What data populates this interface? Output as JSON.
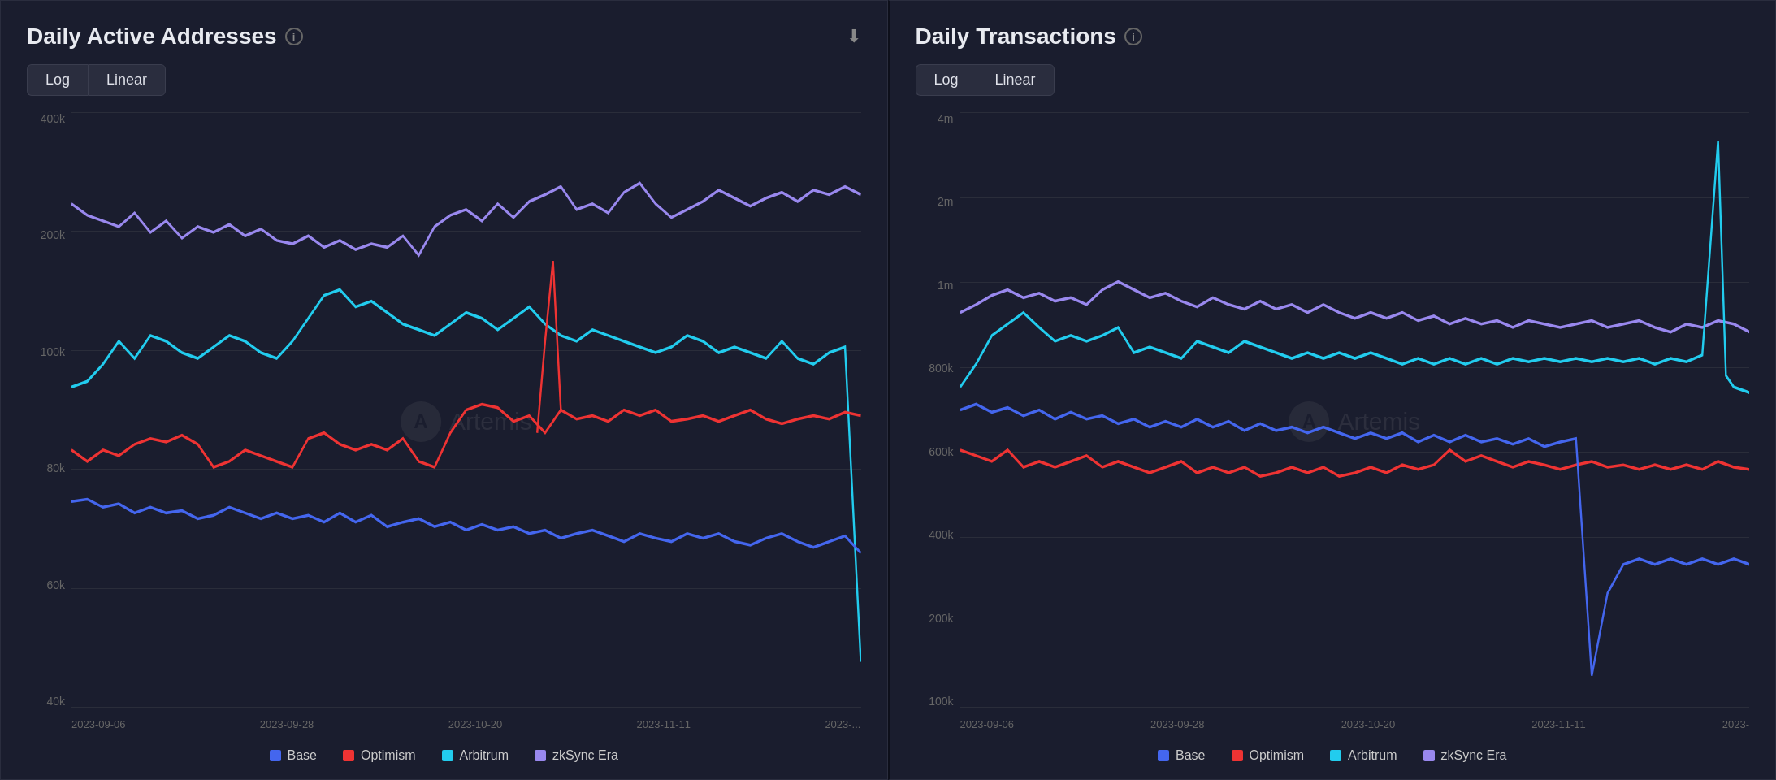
{
  "panels": [
    {
      "id": "daily-active-addresses",
      "title": "Daily Active Addresses",
      "download_icon": "⬇",
      "toggle": {
        "log_label": "Log",
        "linear_label": "Linear",
        "active": "log"
      },
      "y_axis": [
        "400k",
        "200k",
        "100k",
        "80k",
        "60k",
        "40k"
      ],
      "x_axis": [
        "2023-09-06",
        "2023-09-28",
        "2023-10-20",
        "2023-11-11",
        "2023-..."
      ],
      "watermark_text": "Artemis"
    },
    {
      "id": "daily-transactions",
      "title": "Daily Transactions",
      "toggle": {
        "log_label": "Log",
        "linear_label": "Linear",
        "active": "log"
      },
      "y_axis": [
        "4m",
        "2m",
        "1m",
        "800k",
        "600k",
        "400k",
        "200k",
        "100k"
      ],
      "x_axis": [
        "2023-09-06",
        "2023-09-28",
        "2023-10-20",
        "2023-11-11",
        "2023-"
      ],
      "watermark_text": "Artemis"
    }
  ],
  "legend": {
    "items": [
      {
        "label": "Base",
        "color": "#4466ee"
      },
      {
        "label": "Optimism",
        "color": "#ee3333"
      },
      {
        "label": "Arbitrum",
        "color": "#22ccee"
      },
      {
        "label": "zkSync Era",
        "color": "#9988ee"
      }
    ]
  },
  "icons": {
    "info": "i",
    "download": "⬇"
  }
}
